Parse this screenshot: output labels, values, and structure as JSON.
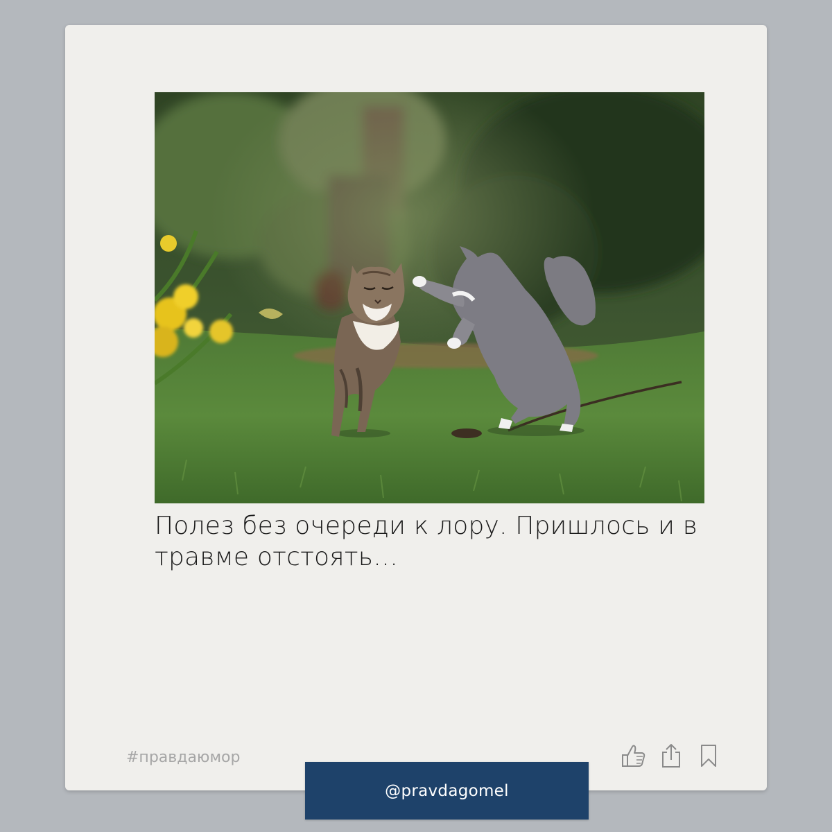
{
  "post": {
    "caption": "Полез без очереди к лору. Пришлось и в травме отстоять…",
    "hashtag": "#правдаюмор",
    "image_description_icon": "photo-two-cats-fighting-on-grass"
  },
  "actions": {
    "like_icon": "thumbs-up-icon",
    "share_icon": "share-icon",
    "bookmark_icon": "bookmark-icon"
  },
  "footer": {
    "handle": "@pravdagomel"
  },
  "colors": {
    "page_background": "#b4b8bd",
    "card_background": "#f0efec",
    "handle_bar": "#1e426a",
    "hashtag": "#a6a6a6",
    "icon": "#8a8a8a"
  }
}
